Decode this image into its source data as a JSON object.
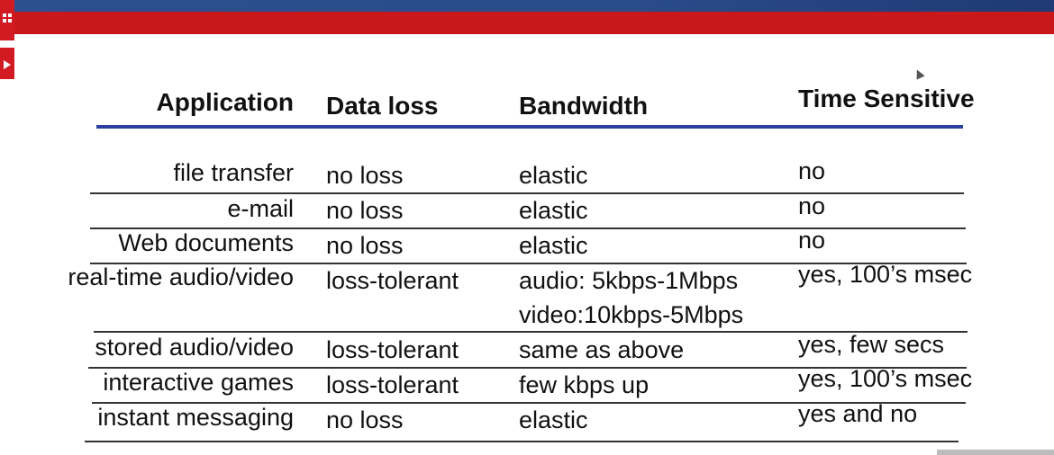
{
  "header": {
    "application": "Application",
    "data_loss": "Data loss",
    "bandwidth": "Bandwidth",
    "time_sensitive": "Time Sensitive"
  },
  "rows": [
    {
      "application": "file transfer",
      "data_loss": "no loss",
      "bandwidth": "elastic",
      "time": "no"
    },
    {
      "application": "e-mail",
      "data_loss": "no loss",
      "bandwidth": "elastic",
      "time": "no"
    },
    {
      "application": "Web documents",
      "data_loss": "no loss",
      "bandwidth": "elastic",
      "time": "no"
    },
    {
      "application": "real-time audio/video",
      "data_loss": "loss-tolerant",
      "bandwidth": "audio: 5kbps-1Mbps",
      "bandwidth2": "video:10kbps-5Mbps",
      "time": "yes, 100’s msec"
    },
    {
      "application": "stored audio/video",
      "data_loss": "loss-tolerant",
      "bandwidth": "same as above",
      "time": "yes, few secs"
    },
    {
      "application": "interactive games",
      "data_loss": "loss-tolerant",
      "bandwidth": "few kbps up",
      "time": "yes, 100’s msec"
    },
    {
      "application": "instant messaging",
      "data_loss": "no loss",
      "bandwidth": "elastic",
      "time": "yes and no"
    }
  ],
  "colors": {
    "title_band": "#2c4f8f",
    "red_band": "#c8181b",
    "header_rule": "#2b3f9f"
  },
  "side_buttons": [
    "grid-icon",
    "play-icon"
  ]
}
